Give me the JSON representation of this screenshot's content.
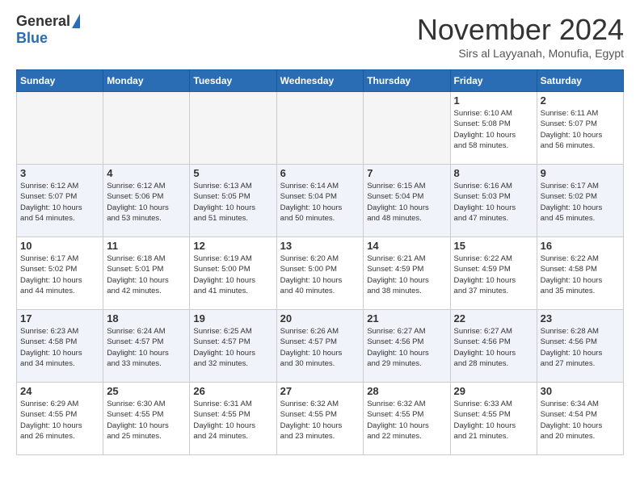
{
  "header": {
    "logo_general": "General",
    "logo_blue": "Blue",
    "month_title": "November 2024",
    "subtitle": "Sirs al Layyanah, Monufia, Egypt"
  },
  "days_of_week": [
    "Sunday",
    "Monday",
    "Tuesday",
    "Wednesday",
    "Thursday",
    "Friday",
    "Saturday"
  ],
  "weeks": [
    {
      "days": [
        {
          "date": "",
          "info": ""
        },
        {
          "date": "",
          "info": ""
        },
        {
          "date": "",
          "info": ""
        },
        {
          "date": "",
          "info": ""
        },
        {
          "date": "",
          "info": ""
        },
        {
          "date": "1",
          "info": "Sunrise: 6:10 AM\nSunset: 5:08 PM\nDaylight: 10 hours\nand 58 minutes."
        },
        {
          "date": "2",
          "info": "Sunrise: 6:11 AM\nSunset: 5:07 PM\nDaylight: 10 hours\nand 56 minutes."
        }
      ]
    },
    {
      "days": [
        {
          "date": "3",
          "info": "Sunrise: 6:12 AM\nSunset: 5:07 PM\nDaylight: 10 hours\nand 54 minutes."
        },
        {
          "date": "4",
          "info": "Sunrise: 6:12 AM\nSunset: 5:06 PM\nDaylight: 10 hours\nand 53 minutes."
        },
        {
          "date": "5",
          "info": "Sunrise: 6:13 AM\nSunset: 5:05 PM\nDaylight: 10 hours\nand 51 minutes."
        },
        {
          "date": "6",
          "info": "Sunrise: 6:14 AM\nSunset: 5:04 PM\nDaylight: 10 hours\nand 50 minutes."
        },
        {
          "date": "7",
          "info": "Sunrise: 6:15 AM\nSunset: 5:04 PM\nDaylight: 10 hours\nand 48 minutes."
        },
        {
          "date": "8",
          "info": "Sunrise: 6:16 AM\nSunset: 5:03 PM\nDaylight: 10 hours\nand 47 minutes."
        },
        {
          "date": "9",
          "info": "Sunrise: 6:17 AM\nSunset: 5:02 PM\nDaylight: 10 hours\nand 45 minutes."
        }
      ]
    },
    {
      "days": [
        {
          "date": "10",
          "info": "Sunrise: 6:17 AM\nSunset: 5:02 PM\nDaylight: 10 hours\nand 44 minutes."
        },
        {
          "date": "11",
          "info": "Sunrise: 6:18 AM\nSunset: 5:01 PM\nDaylight: 10 hours\nand 42 minutes."
        },
        {
          "date": "12",
          "info": "Sunrise: 6:19 AM\nSunset: 5:00 PM\nDaylight: 10 hours\nand 41 minutes."
        },
        {
          "date": "13",
          "info": "Sunrise: 6:20 AM\nSunset: 5:00 PM\nDaylight: 10 hours\nand 40 minutes."
        },
        {
          "date": "14",
          "info": "Sunrise: 6:21 AM\nSunset: 4:59 PM\nDaylight: 10 hours\nand 38 minutes."
        },
        {
          "date": "15",
          "info": "Sunrise: 6:22 AM\nSunset: 4:59 PM\nDaylight: 10 hours\nand 37 minutes."
        },
        {
          "date": "16",
          "info": "Sunrise: 6:22 AM\nSunset: 4:58 PM\nDaylight: 10 hours\nand 35 minutes."
        }
      ]
    },
    {
      "days": [
        {
          "date": "17",
          "info": "Sunrise: 6:23 AM\nSunset: 4:58 PM\nDaylight: 10 hours\nand 34 minutes."
        },
        {
          "date": "18",
          "info": "Sunrise: 6:24 AM\nSunset: 4:57 PM\nDaylight: 10 hours\nand 33 minutes."
        },
        {
          "date": "19",
          "info": "Sunrise: 6:25 AM\nSunset: 4:57 PM\nDaylight: 10 hours\nand 32 minutes."
        },
        {
          "date": "20",
          "info": "Sunrise: 6:26 AM\nSunset: 4:57 PM\nDaylight: 10 hours\nand 30 minutes."
        },
        {
          "date": "21",
          "info": "Sunrise: 6:27 AM\nSunset: 4:56 PM\nDaylight: 10 hours\nand 29 minutes."
        },
        {
          "date": "22",
          "info": "Sunrise: 6:27 AM\nSunset: 4:56 PM\nDaylight: 10 hours\nand 28 minutes."
        },
        {
          "date": "23",
          "info": "Sunrise: 6:28 AM\nSunset: 4:56 PM\nDaylight: 10 hours\nand 27 minutes."
        }
      ]
    },
    {
      "days": [
        {
          "date": "24",
          "info": "Sunrise: 6:29 AM\nSunset: 4:55 PM\nDaylight: 10 hours\nand 26 minutes."
        },
        {
          "date": "25",
          "info": "Sunrise: 6:30 AM\nSunset: 4:55 PM\nDaylight: 10 hours\nand 25 minutes."
        },
        {
          "date": "26",
          "info": "Sunrise: 6:31 AM\nSunset: 4:55 PM\nDaylight: 10 hours\nand 24 minutes."
        },
        {
          "date": "27",
          "info": "Sunrise: 6:32 AM\nSunset: 4:55 PM\nDaylight: 10 hours\nand 23 minutes."
        },
        {
          "date": "28",
          "info": "Sunrise: 6:32 AM\nSunset: 4:55 PM\nDaylight: 10 hours\nand 22 minutes."
        },
        {
          "date": "29",
          "info": "Sunrise: 6:33 AM\nSunset: 4:55 PM\nDaylight: 10 hours\nand 21 minutes."
        },
        {
          "date": "30",
          "info": "Sunrise: 6:34 AM\nSunset: 4:54 PM\nDaylight: 10 hours\nand 20 minutes."
        }
      ]
    }
  ]
}
